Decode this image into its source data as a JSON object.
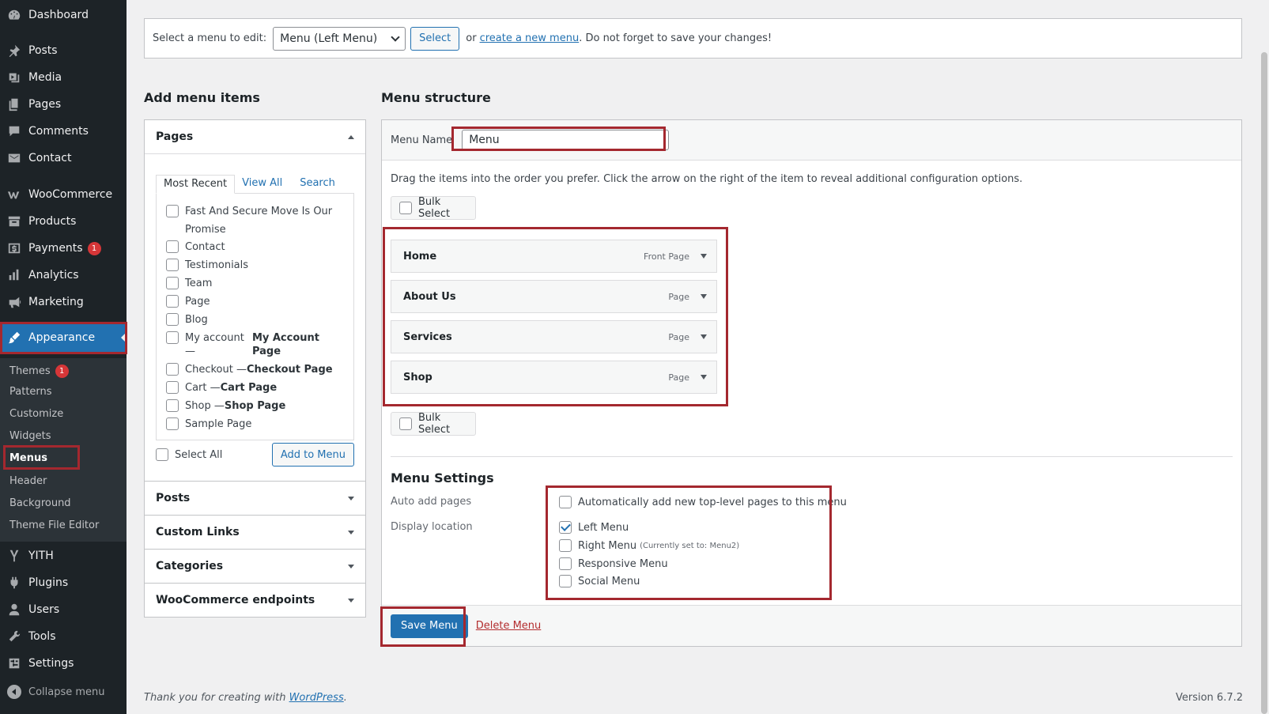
{
  "sidebar": {
    "items": [
      {
        "label": "Dashboard",
        "icon": "dashboard-icon"
      },
      {
        "label": "Posts",
        "icon": "pin-icon"
      },
      {
        "label": "Media",
        "icon": "media-icon"
      },
      {
        "label": "Pages",
        "icon": "pages-icon"
      },
      {
        "label": "Comments",
        "icon": "comment-icon"
      },
      {
        "label": "Contact",
        "icon": "mail-icon"
      },
      {
        "label": "WooCommerce",
        "icon": "woo-icon"
      },
      {
        "label": "Products",
        "icon": "archive-icon"
      },
      {
        "label": "Payments",
        "icon": "payments-icon",
        "badge": "1"
      },
      {
        "label": "Analytics",
        "icon": "bar-chart-icon"
      },
      {
        "label": "Marketing",
        "icon": "megaphone-icon"
      },
      {
        "label": "Appearance",
        "icon": "brush-icon"
      },
      {
        "label": "YITH",
        "icon": "yith-icon"
      },
      {
        "label": "Plugins",
        "icon": "plug-icon"
      },
      {
        "label": "Users",
        "icon": "user-icon"
      },
      {
        "label": "Tools",
        "icon": "wrench-icon"
      },
      {
        "label": "Settings",
        "icon": "sliders-icon"
      }
    ],
    "submenu": [
      {
        "label": "Themes",
        "badge": "1"
      },
      {
        "label": "Patterns"
      },
      {
        "label": "Customize"
      },
      {
        "label": "Widgets"
      },
      {
        "label": "Menus"
      },
      {
        "label": "Header"
      },
      {
        "label": "Background"
      },
      {
        "label": "Theme File Editor"
      }
    ],
    "collapse_label": "Collapse menu"
  },
  "select_bar": {
    "prompt": "Select a menu to edit:",
    "selected": "Menu (Left Menu)",
    "select_button": "Select",
    "or_text": "or",
    "create_link": "create a new menu",
    "suffix": ". Do not forget to save your changes!"
  },
  "add_items": {
    "title": "Add menu items",
    "pages_title": "Pages",
    "tabs": [
      "Most Recent",
      "View All",
      "Search"
    ],
    "pages": [
      {
        "label": "Fast And Secure Move Is Our Promise",
        "suffix": ""
      },
      {
        "label": "Contact",
        "suffix": ""
      },
      {
        "label": "Testimonials",
        "suffix": ""
      },
      {
        "label": "Team",
        "suffix": ""
      },
      {
        "label": "Page",
        "suffix": ""
      },
      {
        "label": "Blog",
        "suffix": ""
      },
      {
        "label": "My account — ",
        "suffix": "My Account Page"
      },
      {
        "label": "Checkout — ",
        "suffix": "Checkout Page"
      },
      {
        "label": "Cart — ",
        "suffix": "Cart Page"
      },
      {
        "label": "Shop — ",
        "suffix": "Shop Page"
      },
      {
        "label": "Sample Page",
        "suffix": ""
      }
    ],
    "select_all": "Select All",
    "add_button": "Add to Menu",
    "sections": [
      "Posts",
      "Custom Links",
      "Categories",
      "WooCommerce endpoints"
    ]
  },
  "structure": {
    "title": "Menu structure",
    "name_label": "Menu Name",
    "name_value": "Menu",
    "instructions": "Drag the items into the order you prefer. Click the arrow on the right of the item to reveal additional configuration options.",
    "bulk_select": "Bulk Select",
    "items": [
      {
        "title": "Home",
        "type": "Front Page"
      },
      {
        "title": "About Us",
        "type": "Page"
      },
      {
        "title": "Services",
        "type": "Page"
      },
      {
        "title": "Shop",
        "type": "Page"
      }
    ],
    "settings_title": "Menu Settings",
    "auto_add_label": "Auto add pages",
    "auto_add_option": "Automatically add new top-level pages to this menu",
    "display_location_label": "Display location",
    "locations": [
      {
        "label": "Left Menu",
        "note": "",
        "checked": true
      },
      {
        "label": "Right Menu",
        "note": "(Currently set to: Menu2)",
        "checked": false
      },
      {
        "label": "Responsive Menu",
        "note": "",
        "checked": false
      },
      {
        "label": "Social Menu",
        "note": "",
        "checked": false
      }
    ],
    "save_button": "Save Menu",
    "delete_link": "Delete Menu"
  },
  "footer": {
    "thanks_prefix": "Thank you for creating with ",
    "thanks_link": "WordPress",
    "thanks_suffix": ".",
    "version": "Version 6.7.2"
  }
}
